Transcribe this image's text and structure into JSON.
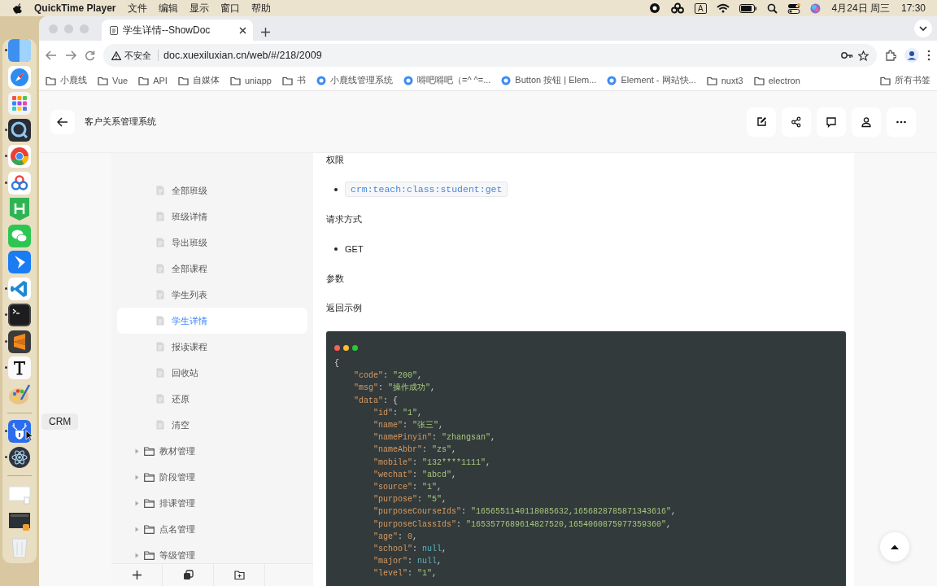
{
  "menu_bar": {
    "app_name": "QuickTime Player",
    "menus": [
      "文件",
      "编辑",
      "显示",
      "窗口",
      "帮助"
    ],
    "input_source": "A",
    "date": "4月24日 周三",
    "time": "17:30"
  },
  "dock": {
    "sections": [
      [
        {
          "kind": "finder",
          "running": true
        },
        {
          "kind": "safari",
          "running": false
        },
        {
          "kind": "launchpad",
          "running": false
        },
        {
          "kind": "quicktime",
          "running": true
        },
        {
          "kind": "chrome",
          "running": true
        },
        {
          "kind": "cloud",
          "running": true
        },
        {
          "kind": "hbuilder",
          "running": false
        },
        {
          "kind": "chat",
          "running": false
        },
        {
          "kind": "feather",
          "running": false
        },
        {
          "kind": "vscode",
          "running": true
        },
        {
          "kind": "terminal",
          "running": true
        },
        {
          "kind": "sublime",
          "running": true
        },
        {
          "kind": "typora",
          "running": true
        },
        {
          "kind": "palette",
          "running": false
        }
      ],
      [
        {
          "kind": "deer",
          "running": true,
          "tooltip": "CRM"
        },
        {
          "kind": "atom",
          "running": true
        }
      ],
      [
        {
          "kind": "document",
          "running": false
        },
        {
          "kind": "screenshot",
          "running": false
        },
        {
          "kind": "trash",
          "running": false
        }
      ]
    ]
  },
  "browser": {
    "tab": {
      "title": "学生详情--ShowDoc"
    },
    "security": "不安全",
    "url": "doc.xuexiluxian.cn/web/#/218/2009",
    "bookmarks": [
      {
        "kind": "folder",
        "label": "小鹿线"
      },
      {
        "kind": "folder",
        "label": "Vue"
      },
      {
        "kind": "folder",
        "label": "API"
      },
      {
        "kind": "folder",
        "label": "自媒体"
      },
      {
        "kind": "folder",
        "label": "uniapp"
      },
      {
        "kind": "folder",
        "label": "书"
      },
      {
        "kind": "site",
        "label": "小鹿线管理系统"
      },
      {
        "kind": "site",
        "label": "嘚吧嘚吧（=^ ^=..."
      },
      {
        "kind": "site",
        "label": "Button 按钮 | Elem..."
      },
      {
        "kind": "site",
        "label": "Element - 网站快..."
      },
      {
        "kind": "folder",
        "label": "nuxt3"
      },
      {
        "kind": "folder",
        "label": "electron"
      }
    ],
    "all_bookmarks": "所有书签"
  },
  "page": {
    "title": "客户关系管理系统",
    "tree": [
      {
        "kind": "doc",
        "label": "全部班级",
        "selected": false
      },
      {
        "kind": "doc",
        "label": "班级详情",
        "selected": false
      },
      {
        "kind": "doc",
        "label": "导出班级",
        "selected": false
      },
      {
        "kind": "doc",
        "label": "全部课程",
        "selected": false
      },
      {
        "kind": "doc",
        "label": "学生列表",
        "selected": false
      },
      {
        "kind": "doc",
        "label": "学生详情",
        "selected": true
      },
      {
        "kind": "doc",
        "label": "报读课程",
        "selected": false
      },
      {
        "kind": "doc",
        "label": "回收站",
        "selected": false
      },
      {
        "kind": "doc",
        "label": "还原",
        "selected": false
      },
      {
        "kind": "doc",
        "label": "清空",
        "selected": false
      },
      {
        "kind": "folder",
        "label": "教材管理",
        "expanded": false
      },
      {
        "kind": "folder",
        "label": "阶段管理",
        "expanded": false
      },
      {
        "kind": "folder",
        "label": "排课管理",
        "expanded": false
      },
      {
        "kind": "folder",
        "label": "点名管理",
        "expanded": false
      },
      {
        "kind": "folder",
        "label": "等级管理",
        "expanded": false
      }
    ],
    "content": [
      {
        "kind": "heading",
        "text": "权限"
      },
      {
        "kind": "code_item",
        "text": "crm:teach:class:student:get"
      },
      {
        "kind": "heading",
        "text": "请求方式"
      },
      {
        "kind": "item",
        "text": "GET"
      },
      {
        "kind": "heading",
        "text": "参数"
      },
      {
        "kind": "heading",
        "text": "返回示例"
      }
    ],
    "code_block": [
      "{",
      "    \"code\": \"200\",",
      "    \"msg\": \"操作成功\",",
      "    \"data\": {",
      "        \"id\": \"1\",",
      "        \"name\": \"张三\",",
      "        \"namePinyin\": \"zhangsan\",",
      "        \"nameAbbr\": \"zs\",",
      "        \"mobile\": \"132****1111\",",
      "        \"wechat\": \"abcd\",",
      "        \"source\": \"1\",",
      "        \"purpose\": \"5\",",
      "        \"purposeCourseIds\": \"1656551140118085632,1656828785871343616\",",
      "        \"purposeClassIds\": \"1653577689614827520,1654060875977359360\",",
      "        \"age\": 0,",
      "        \"school\": null,",
      "        \"major\": null,",
      "        \"level\": \"1\","
    ]
  }
}
